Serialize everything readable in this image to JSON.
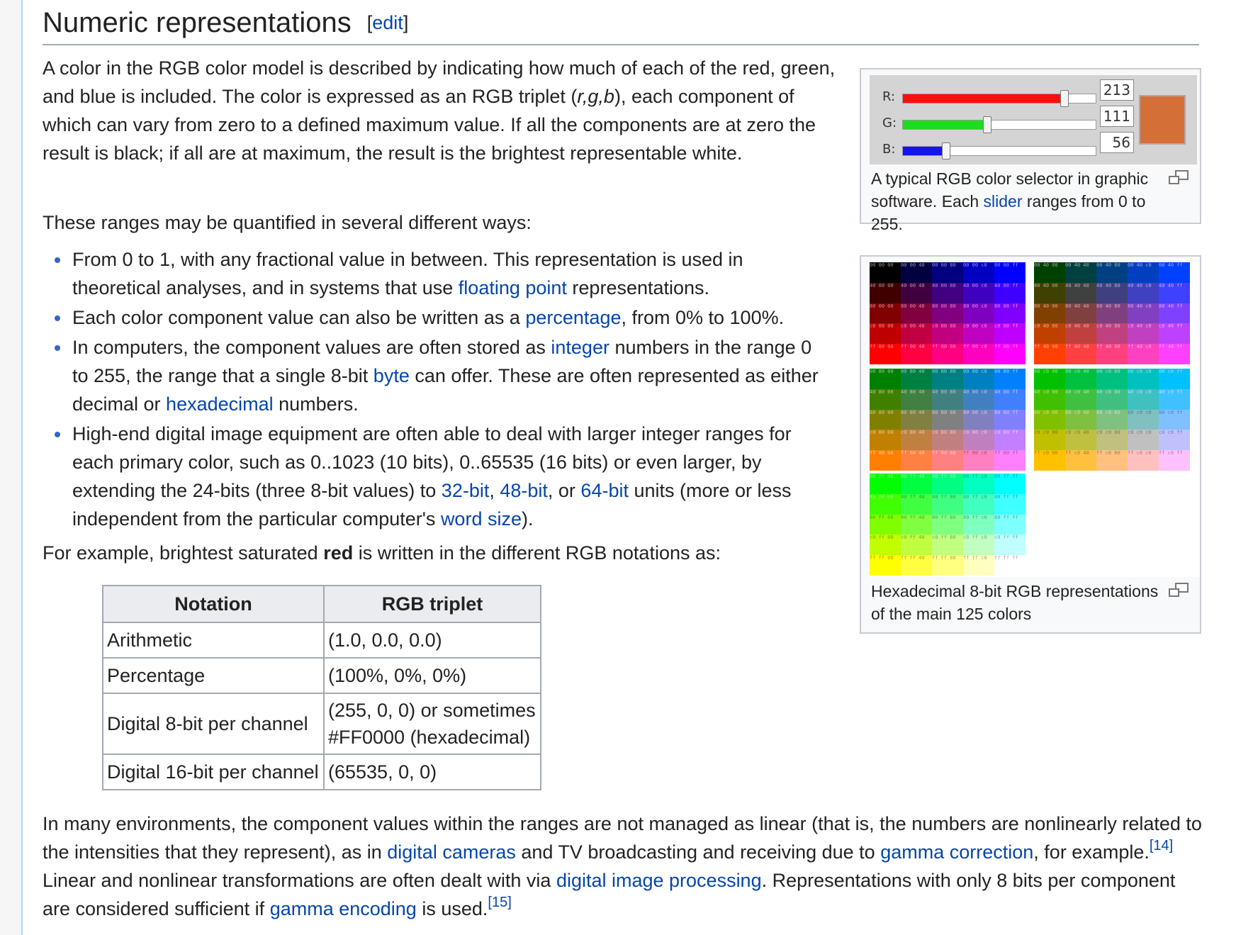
{
  "heading": {
    "title": "Numeric representations",
    "edit": "[edit]"
  },
  "p1": {
    "t1": "A color in the RGB color model is described by indicating how much of each of the red, green, and blue is included. The color is expressed as an RGB triplet (",
    "triplet": "r,g,b",
    "t2": "), each component of which can vary from zero to a defined maximum value. If all the components are at zero the result is black; if all are at maximum, the result is the brightest representable white."
  },
  "p2": "These ranges may be quantified in several different ways:",
  "list": [
    {
      "t1": "From 0 to 1, with any fractional value in between. This representation is used in theoretical analyses, and in systems that use ",
      "l1": "floating point",
      "t2": " representations."
    },
    {
      "t1": "Each color component value can also be written as a ",
      "l1": "percentage",
      "t2": ", from 0% to 100%."
    },
    {
      "t1": "In computers, the component values are often stored as ",
      "l1": "integer",
      "t2": " numbers in the range 0 to 255, the range that a single 8-bit ",
      "l2": "byte",
      "t3": " can offer. These are often represented as either decimal or ",
      "l3": "hexadecimal",
      "t4": " numbers."
    },
    {
      "t1": "High-end digital image equipment are often able to deal with larger integer ranges for each primary color, such as 0..1023 (10 bits), 0..65535 (16 bits) or even larger, by extending the 24-bits (three 8-bit values) to ",
      "l1": "32-bit",
      "t2": ", ",
      "l2": "48-bit",
      "t3": ", or ",
      "l3": "64-bit",
      "t4": " units (more or less independent from the particular computer's ",
      "l4": "word size",
      "t5": ")."
    }
  ],
  "p3": {
    "t1": "For example, brightest saturated ",
    "bold": "red",
    "t2": " is written in the different RGB notations as:"
  },
  "table": {
    "headers": [
      "Notation",
      "RGB triplet"
    ],
    "rows": [
      {
        "notation": "Arithmetic",
        "triplet": "(1.0, 0.0, 0.0)",
        "triplet2": ""
      },
      {
        "notation": "Percentage",
        "triplet": "(100%, 0%, 0%)",
        "triplet2": ""
      },
      {
        "notation": "Digital 8-bit per channel",
        "triplet": "(255, 0, 0) or sometimes",
        "triplet2": "#FF0000 (hexadecimal)"
      },
      {
        "notation": "Digital 16-bit per channel",
        "triplet": "(65535, 0, 0)",
        "triplet2": ""
      }
    ]
  },
  "p4": {
    "t1": "In many environments, the component values within the ranges are not managed as linear (that is, the numbers are nonlinearly related to the intensities that they represent), as in ",
    "l1": "digital cameras",
    "t2": " and TV broadcasting and receiving due to ",
    "l2": "gamma correction",
    "t3": ", for example.",
    "ref1": "[14]",
    "t4": " Linear and nonlinear transformations are often dealt with via ",
    "l3": "digital image processing",
    "t5": ". Representations with only 8 bits per component are considered sufficient if ",
    "l4": "gamma encoding",
    "t6": " is used.",
    "ref2": "[15]"
  },
  "selector": {
    "r_label": "R:",
    "g_label": "G:",
    "b_label": "B:",
    "r": "213",
    "g": "111",
    "b": "56",
    "r_level": 0.835,
    "g_level": 0.435,
    "b_level": 0.22,
    "swatch_color": "#d56f38"
  },
  "caption1": {
    "t1": "A typical RGB color selector in graphic software. Each ",
    "l1": "slider",
    "t2": " ranges from 0 to 255."
  },
  "caption2": "Hexadecimal 8-bit RGB representations of the main 125 colors",
  "colors": {
    "link": "#0645ad",
    "border": "#a2a9b1"
  }
}
